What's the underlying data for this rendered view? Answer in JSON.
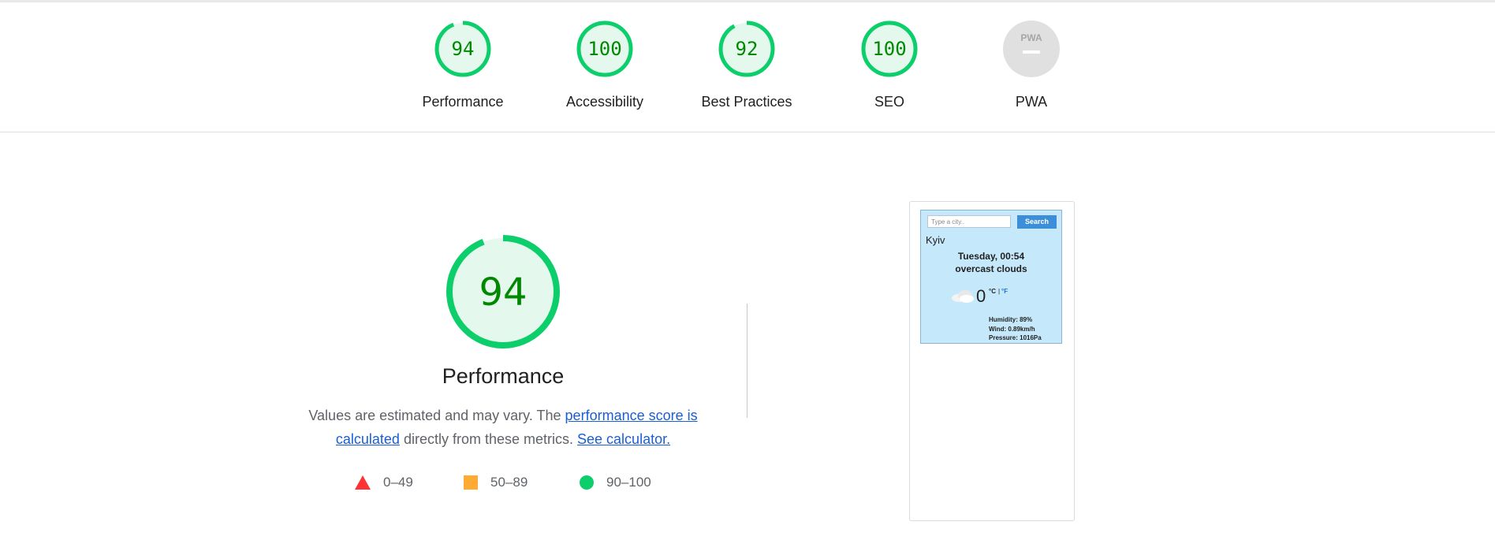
{
  "categories": [
    {
      "label": "Performance",
      "score": "94",
      "fraction": 0.94,
      "color": "#0cce6b"
    },
    {
      "label": "Accessibility",
      "score": "100",
      "fraction": 1.0,
      "color": "#0cce6b"
    },
    {
      "label": "Best Practices",
      "score": "92",
      "fraction": 0.92,
      "color": "#0cce6b"
    },
    {
      "label": "SEO",
      "score": "100",
      "fraction": 1.0,
      "color": "#0cce6b"
    },
    {
      "label": "PWA",
      "badge_text": "PWA",
      "color": "#e0e0e0"
    }
  ],
  "performance": {
    "score": "94",
    "fraction": 0.94,
    "title": "Performance",
    "description_prefix": "Values are estimated and may vary. The ",
    "score_link": "performance score is calculated",
    "description_middle": " directly from these metrics. ",
    "calculator_link": "See calculator."
  },
  "legend": [
    {
      "range": "0–49",
      "shape": "triangle",
      "color": "#ff3333"
    },
    {
      "range": "50–89",
      "shape": "square",
      "color": "#ffaa33"
    },
    {
      "range": "90–100",
      "shape": "circle",
      "color": "#0cce6b"
    }
  ],
  "screenshot": {
    "search_placeholder": "Type a city..",
    "search_button": "Search",
    "city": "Kyiv",
    "day_time": "Tuesday, 00:54",
    "conditions": "overcast clouds",
    "icon": "cloud-icon",
    "temperature": "0",
    "unit_c": "°C",
    "unit_separator": "|",
    "unit_f": "°F",
    "humidity": "Humidity: 89%",
    "wind": "Wind: 0.89km/h",
    "pressure": "Pressure: 1016Pa"
  },
  "colors": {
    "pass": "#0cce6b",
    "pass_text": "#008800",
    "pass_fill": "#e5f8ed",
    "link": "#1a5ed6"
  }
}
